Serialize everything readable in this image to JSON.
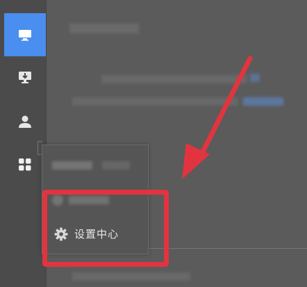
{
  "menu": {
    "settings_label": "设置中心"
  },
  "colors": {
    "accent": "#4a8ef0",
    "annotation": "#e2343f"
  },
  "icons": [
    "monitor-icon",
    "download-monitor-icon",
    "user-icon",
    "apps-grid-icon",
    "gear-icon",
    "arrow-annotation"
  ]
}
